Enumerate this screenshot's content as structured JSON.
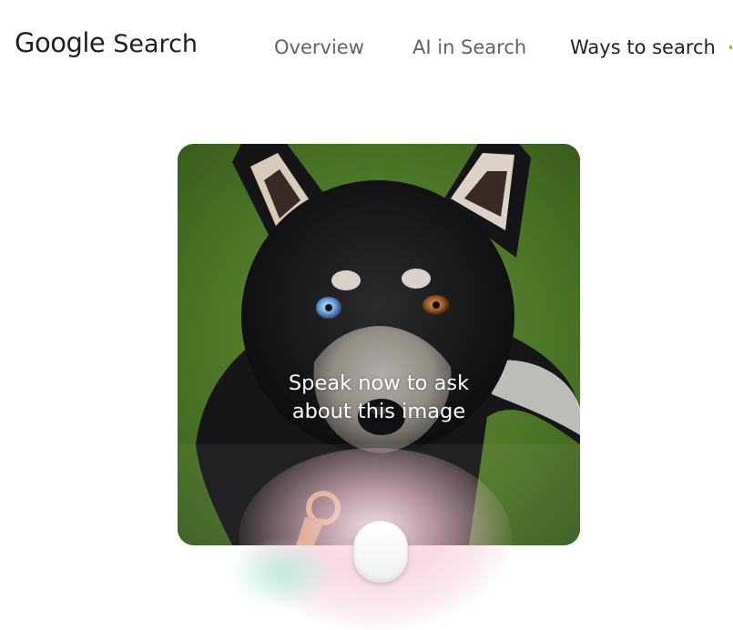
{
  "header": {
    "logo_word": "Google",
    "logo_product": "Search",
    "tabs": [
      {
        "label": "Overview",
        "active": false
      },
      {
        "label": "AI in Search",
        "active": false
      },
      {
        "label": "Ways to search",
        "active": true
      }
    ]
  },
  "main": {
    "prompt_line1": "Speak now to ask",
    "prompt_line2": "about this image"
  },
  "colors": {
    "text_primary": "#202124",
    "text_secondary": "#5f6368",
    "overlay_text": "#ffffff",
    "glow_pink": "#f8c8d4",
    "glow_green": "#aaebd7"
  },
  "icons": {
    "mic": "mic-button-icon"
  }
}
